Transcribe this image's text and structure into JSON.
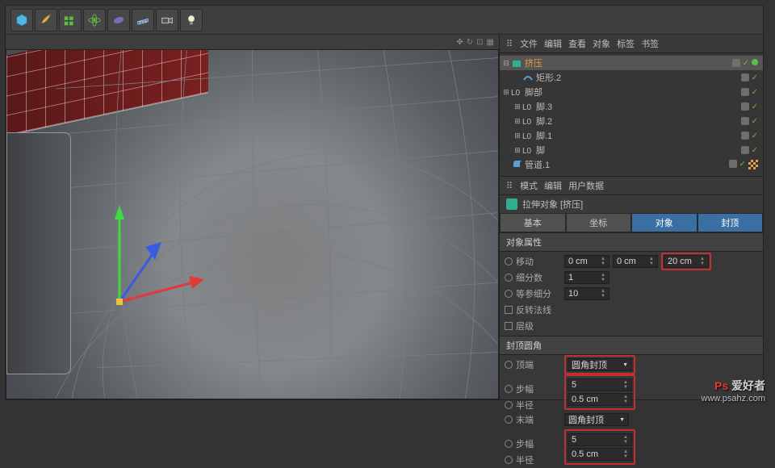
{
  "toolbar": {
    "icons": [
      "cube-icon",
      "brush-icon",
      "array-icon",
      "atom-icon",
      "bean-icon",
      "plane-icon",
      "camera-icon",
      "light-icon"
    ]
  },
  "viewport": {
    "corner_icons": [
      "move-icon",
      "rotate-icon",
      "zoom-icon",
      "frame-icon"
    ]
  },
  "obj_menu": {
    "file": "文件",
    "edit": "编辑",
    "view": "查看",
    "object": "对象",
    "tags": "标签",
    "bookmarks": "书签"
  },
  "hierarchy": [
    {
      "indent": 0,
      "toggle": "⊟",
      "icon": "extrude",
      "label": "挤压",
      "cls": "orange",
      "tags": [
        "grey",
        "green-check",
        "green-dot"
      ]
    },
    {
      "indent": 1,
      "toggle": "",
      "icon": "spline",
      "label": "矩形.2",
      "cls": "",
      "tags": [
        "grey",
        "green-check"
      ]
    },
    {
      "indent": 0,
      "toggle": "⊞",
      "icon": "null",
      "label": "脚部",
      "cls": "",
      "tags": [
        "grey",
        "green-check"
      ]
    },
    {
      "indent": 1,
      "toggle": "⊞",
      "icon": "null",
      "label": "脚.3",
      "cls": "",
      "tags": [
        "grey",
        "green-check"
      ]
    },
    {
      "indent": 1,
      "toggle": "⊞",
      "icon": "null",
      "label": "脚.2",
      "cls": "",
      "tags": [
        "grey",
        "green-check"
      ]
    },
    {
      "indent": 1,
      "toggle": "⊞",
      "icon": "null",
      "label": "脚.1",
      "cls": "",
      "tags": [
        "grey",
        "green-check"
      ]
    },
    {
      "indent": 1,
      "toggle": "⊞",
      "icon": "null",
      "label": "脚",
      "cls": "",
      "tags": [
        "grey",
        "green-check"
      ]
    },
    {
      "indent": 0,
      "toggle": "",
      "icon": "tube",
      "label": "管道.1",
      "cls": "",
      "tags": [
        "grey",
        "green-check",
        "checker"
      ]
    }
  ],
  "attr_menu": {
    "mode": "模式",
    "edit": "编辑",
    "userdata": "用户数据"
  },
  "attr_title": "拉伸对象 [挤压]",
  "tabs": {
    "basic": "基本",
    "coord": "坐标",
    "object": "对象",
    "cap": "封顶"
  },
  "object_props": {
    "header": "对象属性",
    "move": {
      "label": "移动",
      "x": "0 cm",
      "y": "0 cm",
      "z": "20 cm"
    },
    "subdiv": {
      "label": "细分数",
      "val": "1"
    },
    "iso": {
      "label": "等参细分",
      "val": "10"
    },
    "flip": {
      "label": "反转法线"
    },
    "hier": {
      "label": "层级"
    }
  },
  "cap_props": {
    "header": "封顶圆角",
    "start": {
      "label": "顶端",
      "val": "圆角封顶"
    },
    "step1": {
      "label": "步幅",
      "val": "5"
    },
    "radius1": {
      "label": "半径",
      "val": "0.5 cm"
    },
    "end": {
      "label": "末端",
      "val": "圆角封顶"
    },
    "step2": {
      "label": "步幅",
      "val": "5"
    },
    "radius2": {
      "label": "半径",
      "val": "0.5 cm"
    }
  },
  "watermark": {
    "logo_cn": "爱好者",
    "url": "www.psahz.com"
  }
}
